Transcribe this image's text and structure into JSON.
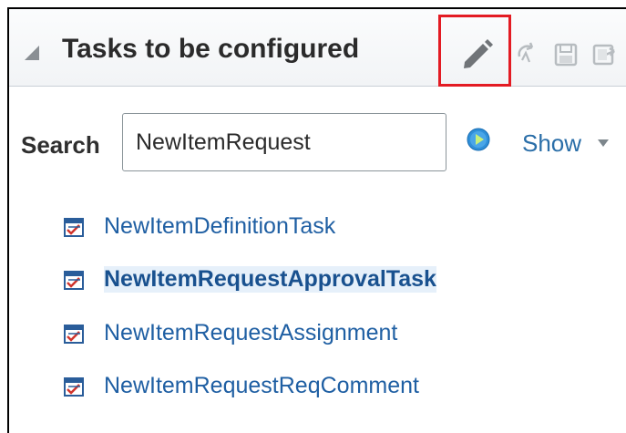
{
  "panel": {
    "title": "Tasks to be configured"
  },
  "toolbar": {
    "icons": [
      "edit-pencil-icon",
      "undo-icon",
      "save-icon",
      "export-icon"
    ],
    "highlight_color": "#e31b23"
  },
  "search": {
    "label": "Search",
    "value": "NewItemRequest",
    "show_label": "Show"
  },
  "tasks": [
    {
      "label": "NewItemDefinitionTask",
      "selected": false
    },
    {
      "label": "NewItemRequestApprovalTask",
      "selected": true
    },
    {
      "label": "NewItemRequestAssignment",
      "selected": false
    },
    {
      "label": "NewItemRequestReqComment",
      "selected": false
    }
  ],
  "colors": {
    "link": "#1f5fa3",
    "go_button": "#2f8fd8"
  }
}
